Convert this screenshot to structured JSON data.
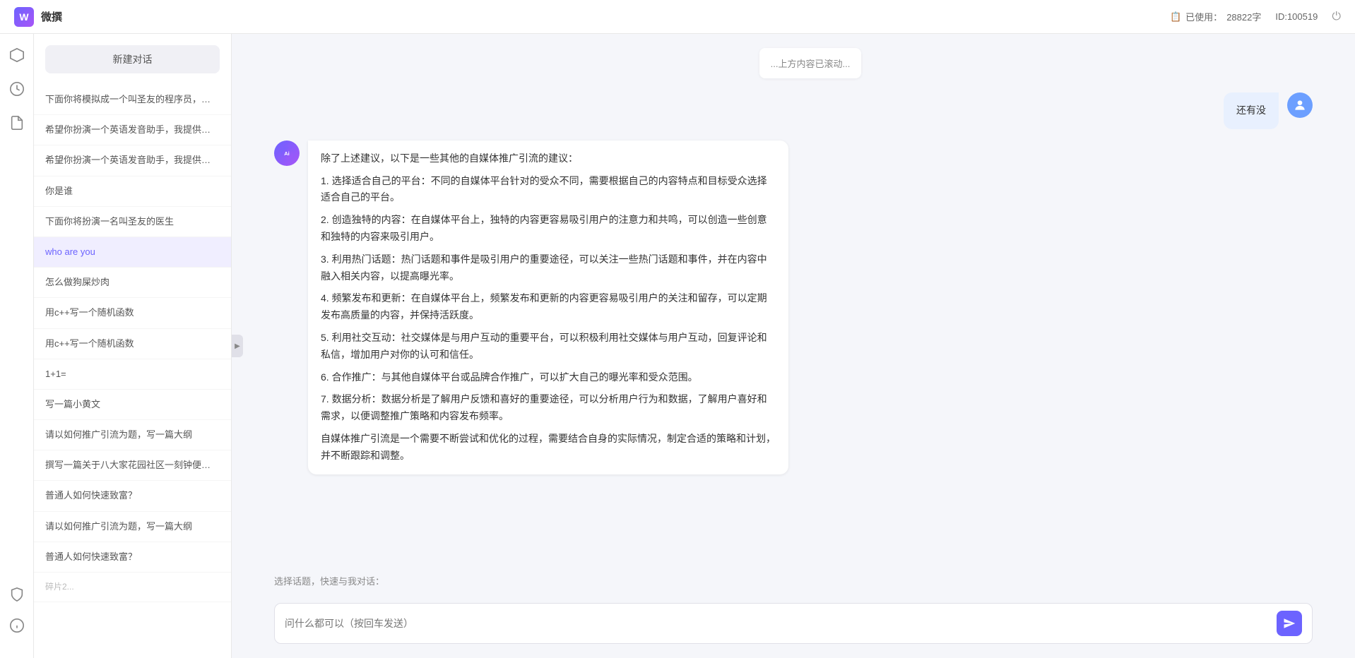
{
  "header": {
    "logo_text": "W",
    "title": "微撰",
    "usage_icon": "📋",
    "usage_label": "已使用：",
    "usage_value": "28822字",
    "id_label": "ID:100519",
    "power_icon": "⏻"
  },
  "icon_sidebar": {
    "icons": [
      {
        "name": "hexagon-icon",
        "symbol": "⬡",
        "active": false
      },
      {
        "name": "clock-icon",
        "symbol": "⏰",
        "active": false
      },
      {
        "name": "document-icon",
        "symbol": "📄",
        "active": false
      }
    ],
    "bottom_icons": [
      {
        "name": "shield-icon",
        "symbol": "🛡"
      },
      {
        "name": "info-icon",
        "symbol": "ℹ"
      }
    ]
  },
  "conversation_sidebar": {
    "new_button_label": "新建对话",
    "items": [
      {
        "id": 1,
        "text": "下面你将模拟成一个叫圣友的程序员，我说...",
        "active": false
      },
      {
        "id": 2,
        "text": "希望你扮演一个英语发音助手，我提供给你...",
        "active": false
      },
      {
        "id": 3,
        "text": "希望你扮演一个英语发音助手，我提供给你...",
        "active": false
      },
      {
        "id": 4,
        "text": "你是谁",
        "active": false
      },
      {
        "id": 5,
        "text": "下面你将扮演一名叫圣友的医生",
        "active": false
      },
      {
        "id": 6,
        "text": "who are you",
        "active": true
      },
      {
        "id": 7,
        "text": "怎么做狗屎炒肉",
        "active": false
      },
      {
        "id": 8,
        "text": "用c++写一个随机函数",
        "active": false
      },
      {
        "id": 9,
        "text": "用c++写一个随机函数",
        "active": false
      },
      {
        "id": 10,
        "text": "1+1=",
        "active": false
      },
      {
        "id": 11,
        "text": "写一篇小黄文",
        "active": false
      },
      {
        "id": 12,
        "text": "请以如何推广引流为题，写一篇大纲",
        "active": false
      },
      {
        "id": 13,
        "text": "撰写一篇关于八大家花园社区一刻钟便民生...",
        "active": false
      },
      {
        "id": 14,
        "text": "普通人如何快速致富？",
        "active": false
      },
      {
        "id": 15,
        "text": "请以如何推广引流为题，写一篇大纲",
        "active": false
      },
      {
        "id": 16,
        "text": "普通人如何快速致富？",
        "active": false
      }
    ]
  },
  "chat": {
    "prev_content_text": "还有没",
    "ai_response": {
      "paragraphs": [
        "除了上述建议，以下是一些其他的自媒体推广引流的建议：",
        "1. 选择适合自己的平台：不同的自媒体平台针对的受众不同，需要根据自己的内容特点和目标受众选择适合自己的平台。",
        "2. 创造独特的内容：在自媒体平台上，独特的内容更容易吸引用户的注意力和共鸣，可以创造一些创意和独特的内容来吸引用户。",
        "3. 利用热门话题：热门话题和事件是吸引用户的重要途径，可以关注一些热门话题和事件，并在内容中融入相关内容，以提高曝光率。",
        "4. 频繁发布和更新：在自媒体平台上，频繁发布和更新的内容更容易吸引用户的关注和留存，可以定期发布高质量的内容，并保持活跃度。",
        "5. 利用社交互动：社交媒体是与用户互动的重要平台，可以积极利用社交媒体与用户互动，回复评论和私信，增加用户对你的认可和信任。",
        "6. 合作推广：与其他自媒体平台或品牌合作推广，可以扩大自己的曝光率和受众范围。",
        "7. 数据分析：数据分析是了解用户反馈和喜好的重要途径，可以分析用户行为和数据，了解用户喜好和需求，以便调整推广策略和内容发布频率。",
        "自媒体推广引流是一个需要不断尝试和优化的过程，需要结合自身的实际情况，制定合适的策略和计划，并不断跟踪和调整。"
      ]
    }
  },
  "input_area": {
    "quick_select_label": "选择话题，快速与我对话：",
    "placeholder": "问什么都可以（按回车发送）",
    "send_icon": "send"
  }
}
